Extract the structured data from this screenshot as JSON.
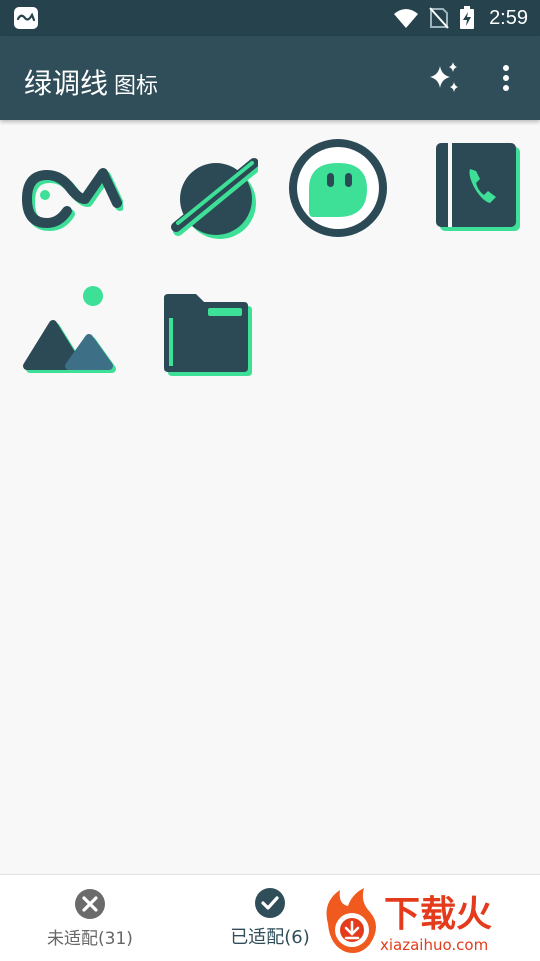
{
  "status_bar": {
    "time": "2:59"
  },
  "app_bar": {
    "title": "绿调线",
    "subtitle": "图标"
  },
  "icons": [
    {
      "name": "brand-logo-icon"
    },
    {
      "name": "browser-icon"
    },
    {
      "name": "chat-icon"
    },
    {
      "name": "phone-icon"
    },
    {
      "name": "gallery-icon"
    },
    {
      "name": "folder-icon"
    }
  ],
  "bottom_nav": {
    "unadapted": "未适配(31)",
    "adapted": "已适配(6)"
  },
  "watermark": {
    "title": "下载火",
    "url": "xiazaihuo.com"
  },
  "colors": {
    "dark": "#2b4a55",
    "accent": "#3ee098",
    "statusbar": "#26434d",
    "appbar": "#2f4e59"
  }
}
